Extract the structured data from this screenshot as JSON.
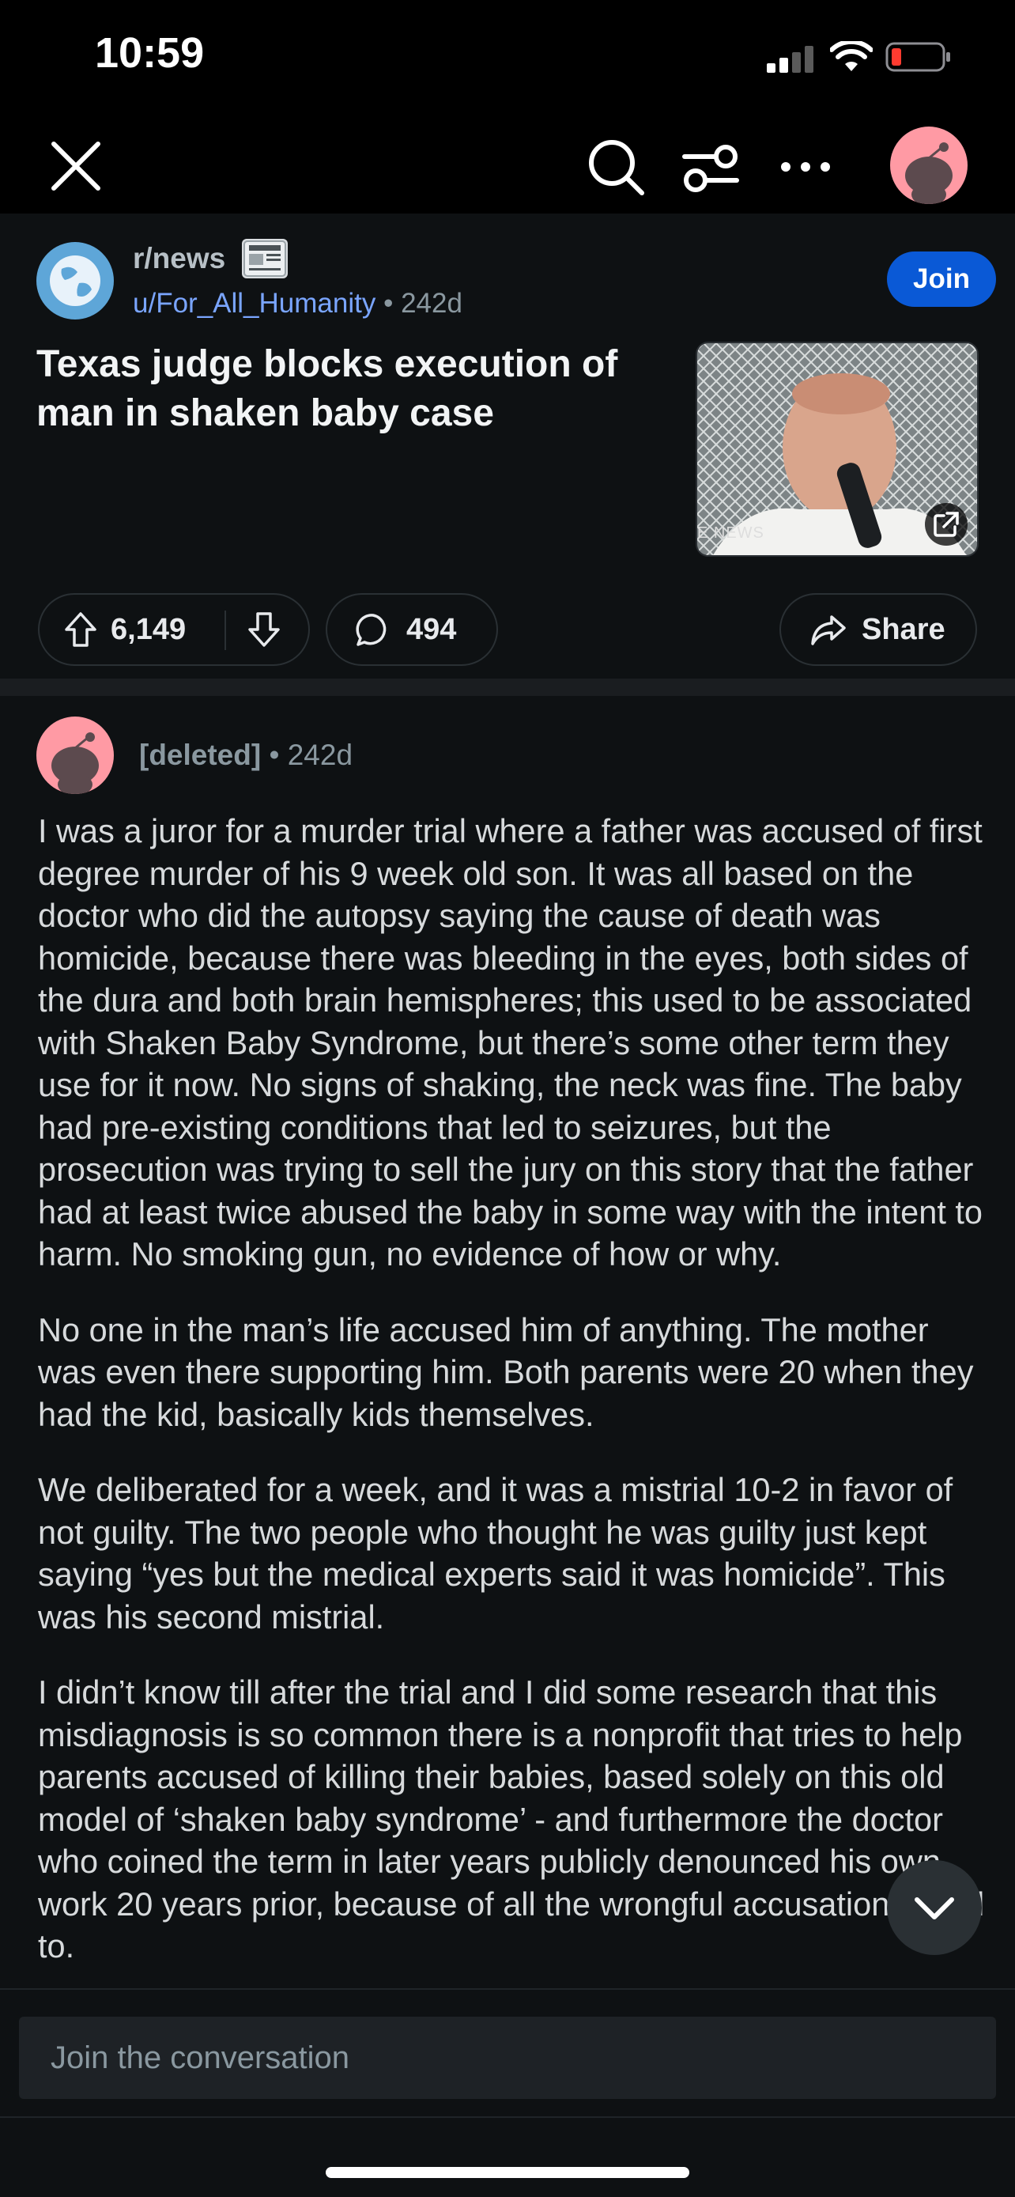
{
  "status": {
    "time": "10:59"
  },
  "post": {
    "subreddit": "r/news",
    "author": "u/For_All_Humanity",
    "separator": "•",
    "age": "242d",
    "join_label": "Join",
    "title": "Texas judge blocks execution of man in shaken baby case",
    "thumbnail_watermark": "E NEWS",
    "upvotes": "6,149",
    "comments": "494",
    "share_label": "Share"
  },
  "comment": {
    "author": "[deleted]",
    "separator": "•",
    "age": "242d",
    "paragraphs": [
      "I was a juror for a murder trial where a father was accused of first degree murder of his 9 week old son. It was all based on the doctor who did the autopsy saying the cause of death was homicide, because there was bleeding in the eyes, both sides of the dura and both brain hemispheres; this used to be associated with Shaken Baby Syndrome, but there’s some other term they use for it now. No signs of shaking, the neck was fine. The baby had pre-existing conditions that led to seizures, but the prosecution was trying to sell the jury on this story that the father had at least twice abused the baby in some way with the intent to harm. No smoking gun, no evidence of how or why.",
      "No one in the man’s life accused him of anything. The mother was even there supporting him. Both parents were 20 when they had the kid, basically kids themselves.",
      "We deliberated for a week, and it was a mistrial 10-2 in favor of not guilty. The two people who thought he was guilty just kept saying “yes but the medical experts said it was homicide”. This was his second mistrial.",
      "I didn’t know till after the trial and I did some research that this misdiagnosis is so common there is a nonprofit that tries to help parents accused of killing their babies, based solely on this old model of ‘shaken baby syndrome’ - and furthermore the doctor who coined the term in later years publicly denounced his own work 20 years prior, because of all the wrongful accusations it led to."
    ]
  },
  "composer": {
    "placeholder": "Join the conversation"
  },
  "colors": {
    "accent": "#0a59d6",
    "link": "#7aa5ff",
    "background": "#0e1113",
    "avatar": "#ff9aa4"
  },
  "icons": [
    "close-icon",
    "search-icon",
    "filter-icon",
    "more-icon",
    "upvote-icon",
    "downvote-icon",
    "comment-icon",
    "share-icon",
    "external-link-icon",
    "chevron-down-icon"
  ]
}
